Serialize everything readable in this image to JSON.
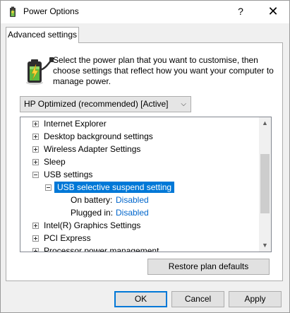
{
  "window": {
    "title": "Power Options",
    "help_glyph": "?",
    "close_glyph": "✕"
  },
  "tab": {
    "label": "Advanced settings"
  },
  "description": "Select the power plan that you want to customise, then choose settings that reflect how you want your computer to manage power.",
  "plan_select": {
    "value": "HP Optimized (recommended) [Active]",
    "arrow": "⌵"
  },
  "tree": {
    "items": [
      {
        "label": "Internet Explorer",
        "expander": "plus"
      },
      {
        "label": "Desktop background settings",
        "expander": "plus"
      },
      {
        "label": "Wireless Adapter Settings",
        "expander": "plus"
      },
      {
        "label": "Sleep",
        "expander": "plus"
      },
      {
        "label": "USB settings",
        "expander": "minus"
      },
      {
        "label": "USB selective suspend setting",
        "expander": "minus",
        "selected": true
      },
      {
        "label": "On battery:",
        "value": "Disabled"
      },
      {
        "label": "Plugged in:",
        "value": "Disabled"
      },
      {
        "label": "Intel(R) Graphics Settings",
        "expander": "plus"
      },
      {
        "label": "PCI Express",
        "expander": "plus"
      },
      {
        "label": "Processor power management",
        "expander": "plus"
      }
    ]
  },
  "scrollbar": {
    "up_glyph": "▲",
    "down_glyph": "▼"
  },
  "buttons": {
    "restore": "Restore plan defaults",
    "ok": "OK",
    "cancel": "Cancel",
    "apply": "Apply"
  },
  "colors": {
    "selection": "#0078d7",
    "link": "#0066cc"
  }
}
